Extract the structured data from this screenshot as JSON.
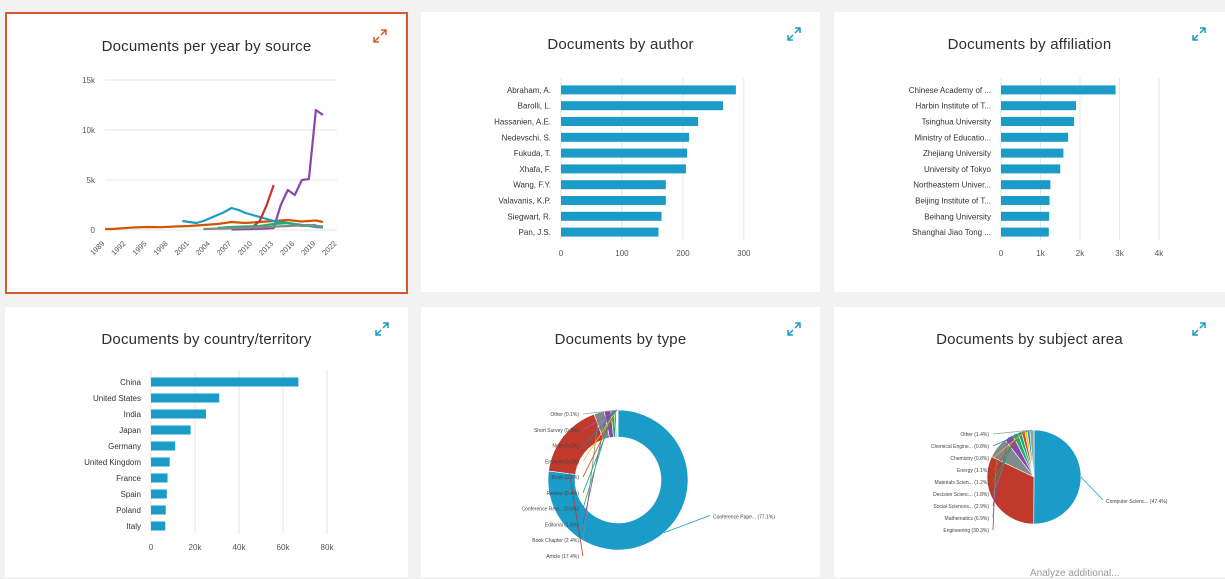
{
  "colors": {
    "bar": "#1a9bc8",
    "selected_border": "#d35c2f",
    "expand_icon": "#1a9bc8",
    "expand_icon_selected": "#d35c2f",
    "grid": "#e6e6e6",
    "axis_text": "#555555"
  },
  "footer_partial_text": "Analyze additional...",
  "chart_data": [
    {
      "id": "per_year",
      "type": "line",
      "title": "Documents per year by source",
      "x_ticks": [
        "1989",
        "1992",
        "1995",
        "1998",
        "2001",
        "2004",
        "2007",
        "2010",
        "2013",
        "2016",
        "2019",
        "2022"
      ],
      "xlim": [
        1989,
        2022
      ],
      "ylim": [
        0,
        15000
      ],
      "y_ticks": [
        0,
        5000,
        10000,
        15000
      ],
      "y_tick_labels": [
        "0",
        "5k",
        "10k",
        "15k"
      ],
      "series": [
        {
          "color": "#8e44ad",
          "x": [
            2007,
            2008,
            2009,
            2010,
            2011,
            2012,
            2013,
            2014,
            2015,
            2016,
            2017,
            2018,
            2019,
            2020
          ],
          "y": [
            50,
            60,
            80,
            100,
            120,
            150,
            200,
            2500,
            4000,
            3500,
            5000,
            5100,
            12000,
            11500
          ]
        },
        {
          "color": "#d35400",
          "x": [
            1989,
            1990,
            1991,
            1993,
            1995,
            1997,
            1999,
            2001,
            2003,
            2005,
            2007,
            2009,
            2011,
            2013,
            2015,
            2017,
            2019,
            2020
          ],
          "y": [
            100,
            100,
            150,
            250,
            300,
            280,
            350,
            400,
            500,
            600,
            800,
            700,
            800,
            900,
            1000,
            850,
            950,
            800
          ]
        },
        {
          "color": "#1a9bc8",
          "x": [
            2000,
            2001,
            2002,
            2003,
            2004,
            2005,
            2006,
            2007,
            2008,
            2009,
            2010,
            2011,
            2012,
            2013,
            2014,
            2015,
            2016,
            2017,
            2018,
            2019,
            2020
          ],
          "y": [
            900,
            800,
            700,
            900,
            1200,
            1500,
            1800,
            2200,
            2000,
            1700,
            1500,
            1300,
            1100,
            900,
            800,
            700,
            600,
            500,
            400,
            300,
            250
          ]
        },
        {
          "color": "#c0392b",
          "x": [
            2010,
            2011,
            2012,
            2013
          ],
          "y": [
            300,
            900,
            2500,
            4500
          ]
        },
        {
          "color": "#27ae60",
          "x": [
            2005,
            2007,
            2009,
            2011,
            2013,
            2015,
            2017,
            2019
          ],
          "y": [
            200,
            300,
            350,
            400,
            600,
            700,
            400,
            500
          ]
        },
        {
          "color": "#7f8c8d",
          "x": [
            2003,
            2006,
            2009,
            2012,
            2015,
            2018,
            2020
          ],
          "y": [
            100,
            150,
            200,
            300,
            400,
            500,
            350
          ]
        }
      ]
    },
    {
      "id": "author",
      "type": "bar",
      "title": "Documents by author",
      "categories": [
        "Abraham, A.",
        "Barolli, L.",
        "Hassanien, A.E.",
        "Nedevschi, S.",
        "Fukuda, T.",
        "Xhafa, F.",
        "Wang, F.Y.",
        "Valavanis, K.P.",
        "Siegwart, R.",
        "Pan, J.S."
      ],
      "values": [
        287,
        266,
        225,
        210,
        207,
        205,
        172,
        172,
        165,
        160
      ],
      "xlim": [
        0,
        320
      ],
      "x_ticks": [
        0,
        100,
        200,
        300
      ],
      "x_tick_labels": [
        "0",
        "100",
        "200",
        "300"
      ]
    },
    {
      "id": "affiliation",
      "type": "bar",
      "title": "Documents by affiliation",
      "categories": [
        "Chinese Academy of ...",
        "Harbin Institute of T...",
        "Tsinghua University",
        "Ministry of Educatio...",
        "Zhejiang University",
        "University of Tokyo",
        "Northeastern Univer...",
        "Beijing Institute of T...",
        "Beihang University",
        "Shanghai Jiao Tong ..."
      ],
      "values": [
        2900,
        1900,
        1850,
        1700,
        1580,
        1500,
        1250,
        1230,
        1220,
        1210
      ],
      "xlim": [
        0,
        4000
      ],
      "x_ticks": [
        0,
        1000,
        2000,
        3000,
        4000
      ],
      "x_tick_labels": [
        "0",
        "1k",
        "2k",
        "3k",
        "4k"
      ]
    },
    {
      "id": "country",
      "type": "bar",
      "title": "Documents by country/territory",
      "categories": [
        "China",
        "United States",
        "India",
        "Japan",
        "Germany",
        "United Kingdom",
        "France",
        "Spain",
        "Poland",
        "Italy"
      ],
      "values": [
        67000,
        31000,
        25000,
        18000,
        11000,
        8500,
        7500,
        7200,
        6700,
        6500
      ],
      "xlim": [
        0,
        80000
      ],
      "x_ticks": [
        0,
        20000,
        40000,
        60000,
        80000
      ],
      "x_tick_labels": [
        "0",
        "20k",
        "40k",
        "60k",
        "80k"
      ]
    },
    {
      "id": "doc_type",
      "type": "pie",
      "title": "Documents by type",
      "donut": true,
      "slices": [
        {
          "label": "Conference Pape... (77.1%)",
          "value": 77.1,
          "color": "#1a9bc8"
        },
        {
          "label": "Article (17.4%)",
          "value": 17.4,
          "color": "#c0392b"
        },
        {
          "label": "Book Chapter (2.4%)",
          "value": 2.4,
          "color": "#7f8c8d"
        },
        {
          "label": "Editorial (1.5%)",
          "value": 1.5,
          "color": "#8e44ad"
        },
        {
          "label": "Conference Revi... (0.8%)",
          "value": 0.8,
          "color": "#27ae60"
        },
        {
          "label": "Review (0.4%)",
          "value": 0.4,
          "color": "#16a085"
        },
        {
          "label": "Book (0.1%)",
          "value": 0.1,
          "color": "#d35400"
        },
        {
          "label": "Erratum (0.1%)",
          "value": 0.1,
          "color": "#f1c40f"
        },
        {
          "label": "Note (0.1%)",
          "value": 0.1,
          "color": "#2980b9"
        },
        {
          "label": "Short Survey (0.0%)",
          "value": 0.05,
          "color": "#9b59b6"
        },
        {
          "label": "Other (0.1%)",
          "value": 0.1,
          "color": "#95a5a6"
        }
      ]
    },
    {
      "id": "subject",
      "type": "pie",
      "title": "Documents by subject area",
      "donut": false,
      "slices": [
        {
          "label": "Computer Scienc... (47.4%)",
          "value": 47.4,
          "color": "#1a9bc8"
        },
        {
          "label": "Engineering (30.3%)",
          "value": 30.3,
          "color": "#c0392b"
        },
        {
          "label": "Mathematics (6.9%)",
          "value": 6.9,
          "color": "#7f8c8d"
        },
        {
          "label": "Social Sciences... (2.9%)",
          "value": 2.9,
          "color": "#8e44ad"
        },
        {
          "label": "Decision Scienc... (1.8%)",
          "value": 1.8,
          "color": "#27ae60"
        },
        {
          "label": "Materials Scien... (1.2%)",
          "value": 1.2,
          "color": "#16a085"
        },
        {
          "label": "Energy (1.1%)",
          "value": 1.1,
          "color": "#d35400"
        },
        {
          "label": "Chemistry (0.8%)",
          "value": 0.8,
          "color": "#f1c40f"
        },
        {
          "label": "Chemical Engine... (0.8%)",
          "value": 0.8,
          "color": "#2980b9"
        },
        {
          "label": "Other (1.4%)",
          "value": 1.4,
          "color": "#95a5a6"
        }
      ]
    }
  ]
}
